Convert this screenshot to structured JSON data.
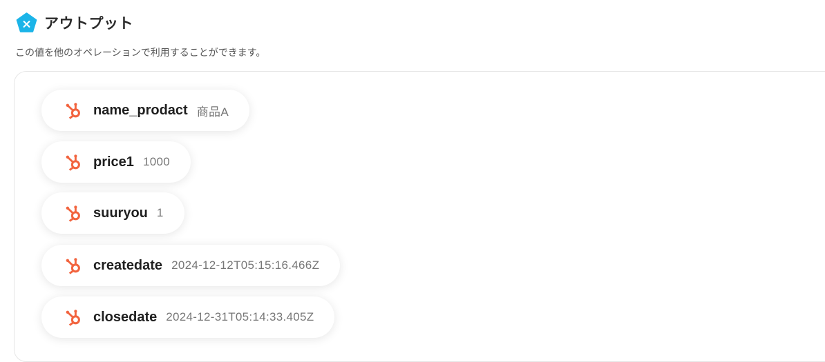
{
  "header": {
    "title": "アウトプット",
    "logo_icon": "yoom-pentagon-x-icon",
    "logo_color": "#1bb4e8"
  },
  "subtitle": "この値を他のオペレーションで利用することができます。",
  "outputs": [
    {
      "key": "name_prodact",
      "value": "商品A",
      "icon": "hubspot-icon"
    },
    {
      "key": "price1",
      "value": "1000",
      "icon": "hubspot-icon"
    },
    {
      "key": "suuryou",
      "value": "1",
      "icon": "hubspot-icon"
    },
    {
      "key": "createdate",
      "value": "2024-12-12T05:15:16.466Z",
      "icon": "hubspot-icon"
    },
    {
      "key": "closedate",
      "value": "2024-12-31T05:14:33.405Z",
      "icon": "hubspot-icon"
    }
  ],
  "colors": {
    "hubspot_orange": "#f2643f",
    "chip_value_gray": "#777777"
  }
}
